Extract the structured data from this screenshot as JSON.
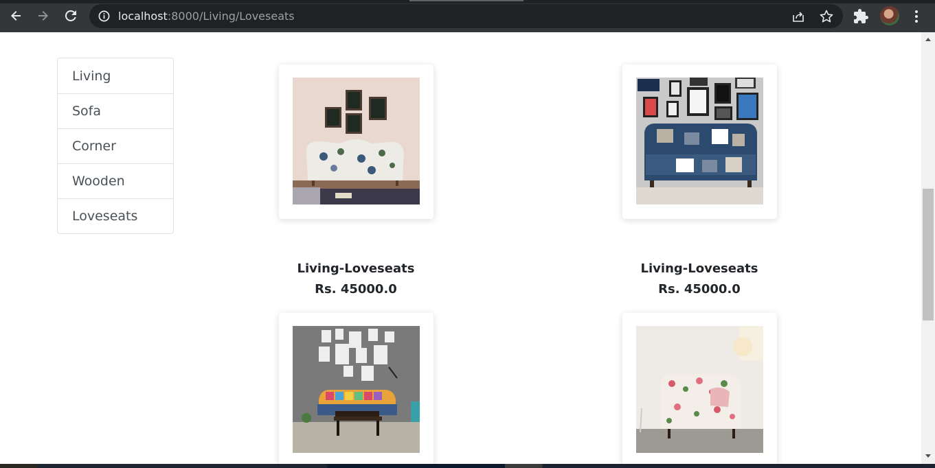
{
  "browser": {
    "url_host": "localhost",
    "url_path": ":8000/Living/Loveseats",
    "icons": [
      "back-icon",
      "forward-icon",
      "reload-icon",
      "info-icon",
      "share-icon",
      "star-icon",
      "extensions-icon",
      "menu-icon"
    ]
  },
  "sidebar": {
    "items": [
      {
        "label": "Living"
      },
      {
        "label": "Sofa"
      },
      {
        "label": "Corner"
      },
      {
        "label": "Wooden"
      },
      {
        "label": "Loveseats"
      }
    ]
  },
  "products": [
    {
      "name": "Living-Loveseats",
      "price": "Rs. 45000.0"
    },
    {
      "name": "Living-Loveseats",
      "price": "Rs. 45000.0"
    }
  ],
  "colors": {
    "chrome_bg": "#35363a",
    "omnibox_bg": "#202124",
    "text_dark": "#212529",
    "sidebar_text": "#495057",
    "border": "#dee2e6"
  }
}
